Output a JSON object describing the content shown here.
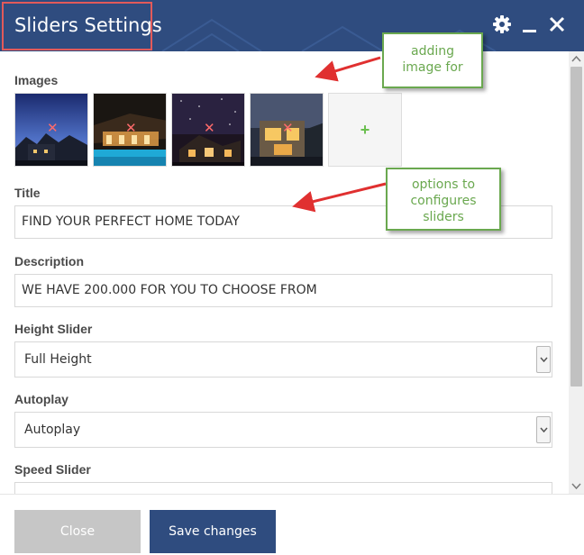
{
  "dialog": {
    "title": "Sliders Settings",
    "header_icons": [
      "gear-icon",
      "minimize-icon",
      "close-icon"
    ]
  },
  "images": {
    "label": "Images",
    "thumbnails": [
      {
        "name": "house-dusk",
        "remove_glyph": "✕"
      },
      {
        "name": "pool-night",
        "remove_glyph": "✕"
      },
      {
        "name": "house-starry-night",
        "remove_glyph": "✕"
      },
      {
        "name": "house-lit-window",
        "remove_glyph": "✕"
      }
    ],
    "add_label": "+"
  },
  "fields": {
    "title": {
      "label": "Title",
      "value": "FIND YOUR PERFECT HOME TODAY"
    },
    "description": {
      "label": "Description",
      "value": "WE HAVE 200.000 FOR YOU TO CHOOSE FROM"
    },
    "height_slider": {
      "label": "Height Slider",
      "value": "Full Height"
    },
    "autoplay": {
      "label": "Autoplay",
      "value": "Autoplay"
    },
    "speed_slider": {
      "label": "Speed Slider",
      "value": ""
    }
  },
  "annotations": {
    "adding_images": "adding image for",
    "options": "options to configures sliders"
  },
  "footer": {
    "close_label": "Close",
    "save_label": "Save changes"
  },
  "colors": {
    "header": "#2f4c7f",
    "save_button": "#2f4c7f",
    "close_button": "#c6c6c6",
    "callout": "#6aa84f",
    "arrow": "#e03030",
    "title_outline": "#e25a5a"
  }
}
